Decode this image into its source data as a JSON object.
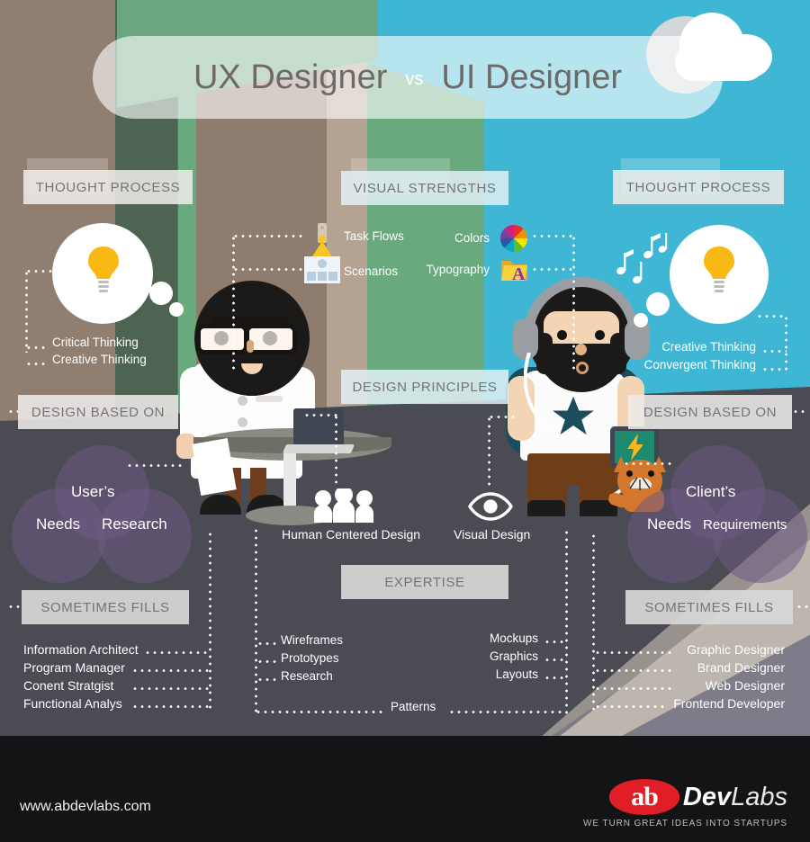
{
  "title": {
    "left": "UX Designer",
    "vs": "vs",
    "right": "UI Designer"
  },
  "sections": {
    "left_thought_process": "THOUGHT PROCESS",
    "visual_strengths": "VISUAL STRENGTHS",
    "right_thought_process": "THOUGHT PROCESS",
    "design_principles": "DESIGN PRINCIPLES",
    "left_design_based_on": "DESIGN BASED ON",
    "right_design_based_on": "DESIGN BASED ON",
    "expertise": "EXPERTISE",
    "left_sometimes_fills": "SOMETIMES FILLS",
    "right_sometimes_fills": "SOMETIMES FILLS"
  },
  "ux": {
    "thought_process": [
      "Critical  Thinking",
      "Creative Thinking"
    ],
    "design_based_on": {
      "top": "User’s",
      "left": "Needs",
      "right": "Research"
    },
    "sometimes_fills": [
      "Information Architect",
      "Program Manager",
      "Conent Stratgist",
      "Functional Analys"
    ],
    "expertise": [
      "Wireframes",
      "Prototypes",
      "Research"
    ]
  },
  "ui": {
    "thought_process": [
      "Creative Thinking",
      "Convergent Thinking"
    ],
    "design_based_on": {
      "top": "Client’s",
      "left": "Needs",
      "right": "Requirements"
    },
    "sometimes_fills": [
      "Graphic Designer",
      "Brand Designer",
      "Web Designer",
      "Frontend Developer"
    ],
    "expertise": [
      "Mockups",
      "Graphics",
      "Layouts"
    ]
  },
  "visual_strengths": {
    "ux": [
      {
        "label": "Task Flows",
        "icon": "funnel-icon"
      },
      {
        "label": "Scenarios",
        "icon": "wireframe-icon"
      }
    ],
    "ui": [
      {
        "label": "Colors",
        "icon": "color-wheel-icon"
      },
      {
        "label": "Typography",
        "icon": "typography-icon"
      }
    ]
  },
  "design_principles": {
    "ux": {
      "label": "Human Centered Design",
      "icon": "people-group-icon"
    },
    "ui": {
      "label": "Visual Design",
      "icon": "eye-icon"
    }
  },
  "shared_expertise": "Patterns",
  "footer": {
    "url": "www.abdevlabs.com",
    "logo_mark": "ab",
    "logo_dev": "Dev",
    "logo_labs": "Labs",
    "tagline": "WE TURN GREAT IDEAS INTO STARTUPS"
  },
  "colors": {
    "cyan": "#3fb7d4",
    "taupe": "#907e70",
    "green": "#69a97e",
    "floor": "#4b4b53",
    "venn_purple": "#6d5a84",
    "bulb_yellow": "#f9b814",
    "chip_text": "#74737a",
    "logo_red": "#e01e26",
    "footer_bg": "#141416"
  }
}
